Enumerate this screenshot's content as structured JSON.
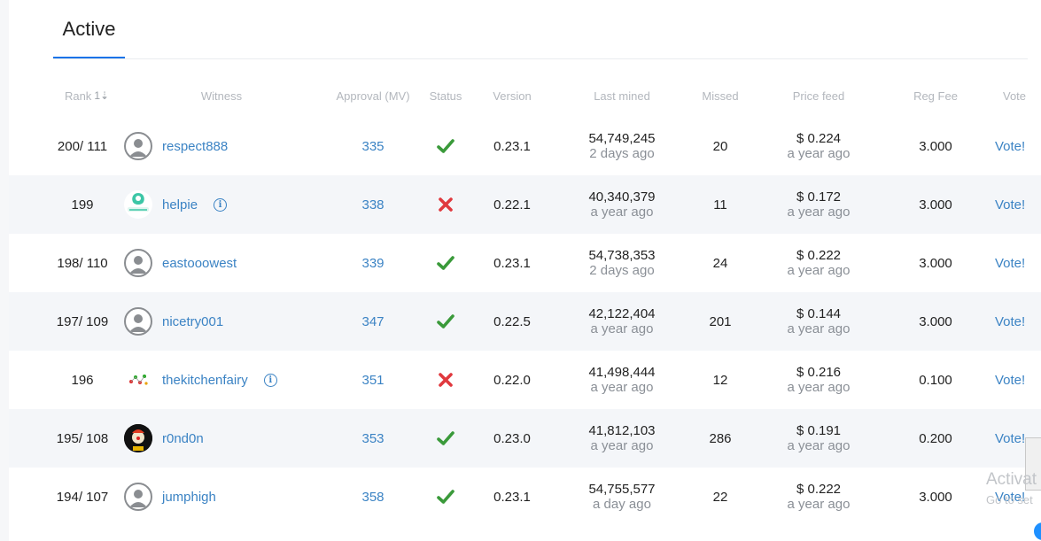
{
  "tabs": [
    {
      "label": "Active"
    }
  ],
  "columns": {
    "rank": "Rank",
    "witness": "Witness",
    "approval": "Approval (MV)",
    "status": "Status",
    "version": "Version",
    "last_mined": "Last mined",
    "missed": "Missed",
    "price_feed": "Price feed",
    "reg_fee": "Reg Fee",
    "vote": "Vote"
  },
  "sort_indicator": "1⇣",
  "rows": [
    {
      "rank": "200/ 111",
      "name": "respect888",
      "avatar": "generic",
      "info": false,
      "approval": "335",
      "status": "ok",
      "version": "0.23.1",
      "block": "54,749,245",
      "block_age": "2 days ago",
      "missed": "20",
      "price": "$ 0.224",
      "price_age": "a year ago",
      "fee": "3.000",
      "vote": "Vote!"
    },
    {
      "rank": "199",
      "name": "helpie",
      "avatar": "helpie",
      "info": true,
      "approval": "338",
      "status": "fail",
      "version": "0.22.1",
      "block": "40,340,379",
      "block_age": "a year ago",
      "missed": "11",
      "price": "$ 0.172",
      "price_age": "a year ago",
      "fee": "3.000",
      "vote": "Vote!"
    },
    {
      "rank": "198/ 110",
      "name": "eastooowest",
      "avatar": "generic",
      "info": false,
      "approval": "339",
      "status": "ok",
      "version": "0.23.1",
      "block": "54,738,353",
      "block_age": "2 days ago",
      "missed": "24",
      "price": "$ 0.222",
      "price_age": "a year ago",
      "fee": "3.000",
      "vote": "Vote!"
    },
    {
      "rank": "197/ 109",
      "name": "nicetry001",
      "avatar": "generic",
      "info": false,
      "approval": "347",
      "status": "ok",
      "version": "0.22.5",
      "block": "42,122,404",
      "block_age": "a year ago",
      "missed": "201",
      "price": "$ 0.144",
      "price_age": "a year ago",
      "fee": "3.000",
      "vote": "Vote!"
    },
    {
      "rank": "196",
      "name": "thekitchenfairy",
      "avatar": "kitchen",
      "info": true,
      "approval": "351",
      "status": "fail",
      "version": "0.22.0",
      "block": "41,498,444",
      "block_age": "a year ago",
      "missed": "12",
      "price": "$ 0.216",
      "price_age": "a year ago",
      "fee": "0.100",
      "vote": "Vote!"
    },
    {
      "rank": "195/ 108",
      "name": "r0nd0n",
      "avatar": "clown",
      "info": false,
      "approval": "353",
      "status": "ok",
      "version": "0.23.0",
      "block": "41,812,103",
      "block_age": "a year ago",
      "missed": "286",
      "price": "$ 0.191",
      "price_age": "a year ago",
      "fee": "0.200",
      "vote": "Vote!"
    },
    {
      "rank": "194/ 107",
      "name": "jumphigh",
      "avatar": "generic",
      "info": false,
      "approval": "358",
      "status": "ok",
      "version": "0.23.1",
      "block": "54,755,577",
      "block_age": "a day ago",
      "missed": "22",
      "price": "$ 0.222",
      "price_age": "a year ago",
      "fee": "3.000",
      "vote": "Vote!"
    }
  ],
  "overlay": {
    "line1": "Activat",
    "line2": "Go to set"
  },
  "colors": {
    "link": "#3b83c4",
    "ok": "#3a9a3a",
    "fail": "#e0393e",
    "tab_underline": "#1a73e8"
  },
  "icons": {
    "ok": "check-icon",
    "fail": "cross-icon",
    "info": "info-icon",
    "avatar": "user-icon"
  }
}
